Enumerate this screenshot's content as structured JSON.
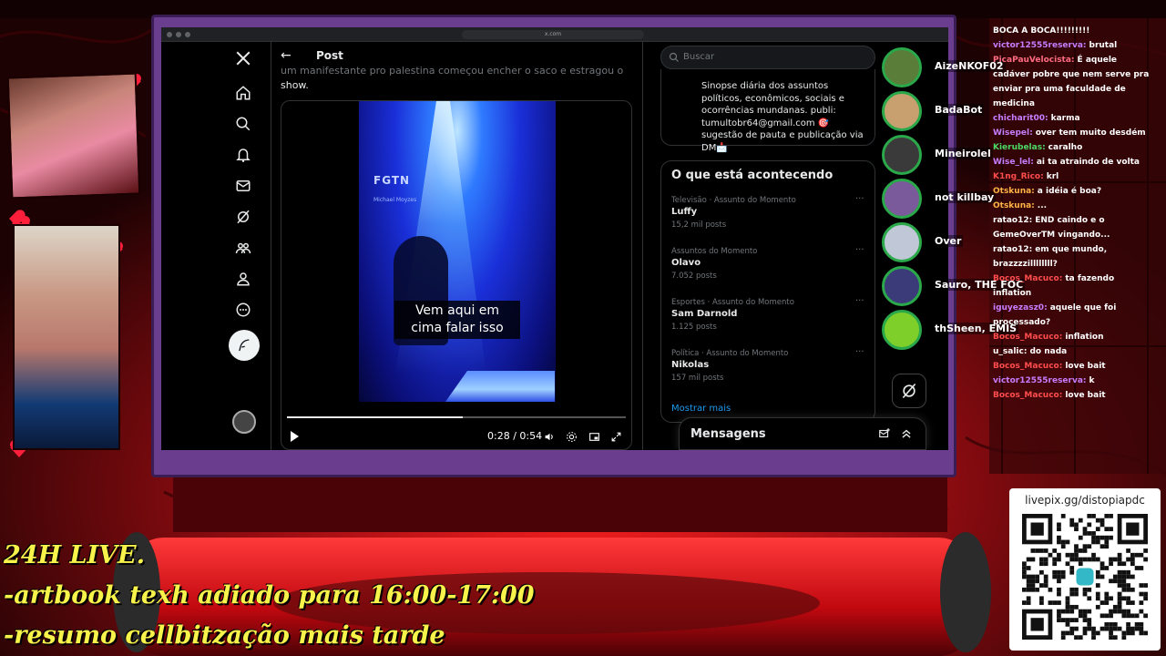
{
  "browser": {
    "url": "x.com"
  },
  "x_nav": {
    "items": [
      "x-logo",
      "home-icon",
      "search-icon",
      "bell-icon",
      "mail-icon",
      "grok-icon",
      "communities-icon",
      "profile-icon",
      "more-icon"
    ],
    "compose_icon": "feather-icon"
  },
  "post": {
    "back_label": "←",
    "title": "Post",
    "text_faded": "um manifestante pro palestina começou encher o saco e estragou o",
    "text": "show.",
    "video": {
      "logo": "FGTN",
      "logo_sub": "Michael Moyzes",
      "caption": "Vem aqui em cima falar isso",
      "time": "0:28 / 0:54",
      "progress": 0.52
    }
  },
  "search": {
    "placeholder": "Buscar"
  },
  "bio": {
    "text": "Sinopse diária dos assuntos políticos, econômicos, sociais e ocorrências mundanas. publi: tumultobr64@gmail.com 🎯 sugestão de pauta e publicação via DM📩"
  },
  "trends": {
    "title": "O que está acontecendo",
    "items": [
      {
        "category": "Televisão · Assunto do Momento",
        "name": "Luffy",
        "count": "15,2 mil posts"
      },
      {
        "category": "Assuntos do Momento",
        "name": "Olavo",
        "count": "7.052 posts"
      },
      {
        "category": "Esportes · Assunto do Momento",
        "name": "Sam Darnold",
        "count": "1.125 posts"
      },
      {
        "category": "Política · Assunto do Momento",
        "name": "Nikolas",
        "count": "157 mil posts"
      }
    ],
    "more_icon": "···",
    "show_more": "Mostrar mais"
  },
  "messages": {
    "title": "Mensagens"
  },
  "viewers": [
    {
      "name": "AizeNKOF02",
      "color": "#5a7d3a"
    },
    {
      "name": "BadaBot",
      "color": "#c8a070"
    },
    {
      "name": "Mineirolel",
      "color": "#3a3a3a"
    },
    {
      "name": "not killbay",
      "color": "#7a5a9a"
    },
    {
      "name": "Over",
      "color": "#c0c8d8"
    },
    {
      "name": "Sauro, THE FOC",
      "color": "#3b3b7a"
    },
    {
      "name": "thSheen, EMIS",
      "color": "#7fcf2a"
    }
  ],
  "chat": {
    "header": "BOCA A BOCA!!!!!!!!!",
    "messages": [
      {
        "user": "victor12555reserva:",
        "text": "brutal",
        "color": "#c77dff"
      },
      {
        "user": "PicaPauVelocista:",
        "text": "É aquele",
        "color": "#ff6b81"
      },
      {
        "user": "",
        "text": "cadáver pobre que nem serve pra",
        "color": "#ffffff"
      },
      {
        "user": "",
        "text": "enviar pra uma faculdade de",
        "color": "#ffffff"
      },
      {
        "user": "",
        "text": "medicina",
        "color": "#ffffff"
      },
      {
        "user": "chicharit00:",
        "text": "karma",
        "color": "#c77dff"
      },
      {
        "user": "Wisepel:",
        "text": "over tem muito desdém",
        "color": "#c77dff"
      },
      {
        "user": "Kierubelas:",
        "text": "caralho",
        "color": "#4cd964"
      },
      {
        "user": "Wise_lel:",
        "text": "ai ta atraindo de volta",
        "color": "#c77dff"
      },
      {
        "user": "K1ng_Rico:",
        "text": "krl",
        "color": "#ff4d4d"
      },
      {
        "user": "Otskuna:",
        "text": "a idéia é boa?",
        "color": "#ffb347"
      },
      {
        "user": "Otskuna:",
        "text": "...",
        "color": "#ffb347"
      },
      {
        "user": "ratao12:",
        "text": "END caindo e o",
        "color": "#ffffff"
      },
      {
        "user": "",
        "text": "GemeOverTM vingando...",
        "color": "#ffffff"
      },
      {
        "user": "ratao12:",
        "text": "em que mundo,",
        "color": "#ffffff"
      },
      {
        "user": "",
        "text": "brazzzzillllllll?",
        "color": "#ffffff"
      },
      {
        "user": "Bocos_Macuco:",
        "text": "ta fazendo",
        "color": "#ff4d4d"
      },
      {
        "user": "",
        "text": "inflation",
        "color": "#ffffff"
      },
      {
        "user": "iguyezasz0:",
        "text": "aquele que foi",
        "color": "#c77dff"
      },
      {
        "user": "",
        "text": "processado?",
        "color": "#ffffff"
      },
      {
        "user": "Bocos_Macuco:",
        "text": "inflation",
        "color": "#ff4d4d"
      },
      {
        "user": "u_salic:",
        "text": "do nada",
        "color": "#ffffff"
      },
      {
        "user": "Bocos_Macuco:",
        "text": "love bait",
        "color": "#ff4d4d"
      },
      {
        "user": "victor12555reserva:",
        "text": "k",
        "color": "#c77dff"
      },
      {
        "user": "Bocos_Macuco:",
        "text": "love bait",
        "color": "#ff4d4d"
      }
    ]
  },
  "ticker": {
    "line1": "24H LIVE.",
    "line2": "-artbook texh adiado para 16:00-17:00",
    "line3": "-resumo cellbitzação mais tarde"
  },
  "qr": {
    "label": "livepix.gg/distopiapdc"
  },
  "colors": {
    "accent": "#1d9bf0",
    "ticker": "#f7f34a",
    "frame": "#6a3d8e"
  }
}
